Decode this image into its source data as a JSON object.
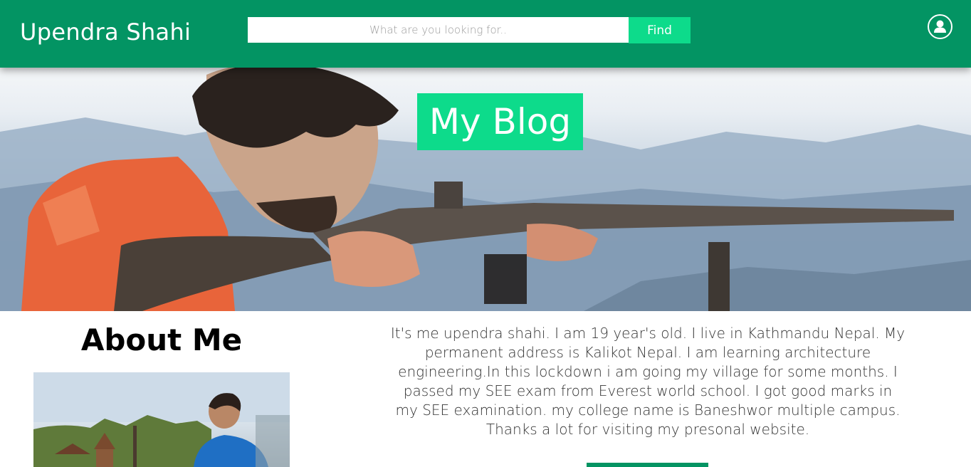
{
  "header": {
    "brand": "Upendra Shahi",
    "search": {
      "placeholder": "What are you looking for..",
      "value": ""
    },
    "find_label": "Find",
    "user_icon": "user-icon"
  },
  "hero": {
    "title": "My Blog",
    "image": "banner-photo-man-aiming-rifle-mountains"
  },
  "about": {
    "heading": "About Me",
    "photo": "profile-photo-temple-background",
    "text": "It's me upendra shahi. I am 19 year's old. I live in Kathmandu Nepal. My permanent address is Kalikot Nepal. I am learning architecture engineering.In this lockdown i am going my village for some months. I passed my SEE exam from Everest world school. I got good marks in my SEE examination. my college name is Baneshwor multiple campus. Thanks a lot for visiting my presonal website."
  },
  "colors": {
    "header_bg": "#039463",
    "accent": "#0ddb8b"
  }
}
